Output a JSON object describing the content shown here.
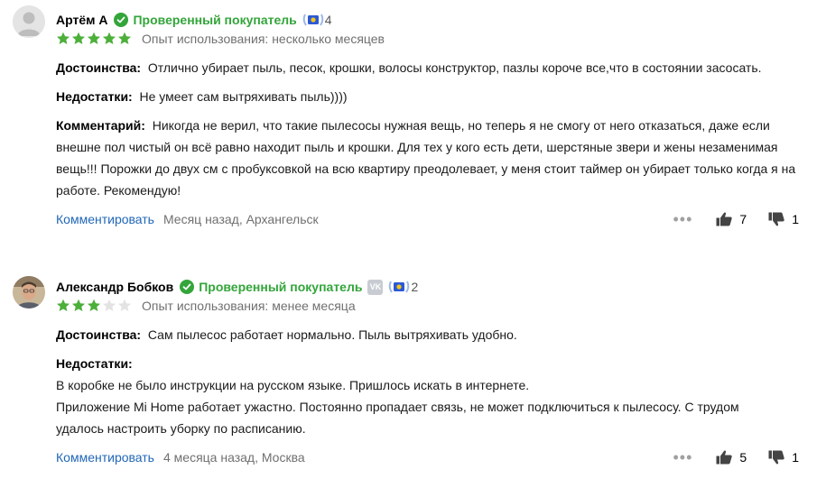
{
  "reviews": [
    {
      "author": "Артём А",
      "verified": "Проверенный покупатель",
      "badge_level": "4",
      "has_vk": false,
      "rating": 5,
      "usage": "Опыт использования: несколько месяцев",
      "pros_label": "Достоинства:",
      "pros": "Отлично убирает пыль, песок, крошки, волосы конструктор, пазлы короче все,что в состоянии засосать.",
      "cons_label": "Недостатки:",
      "cons": "Не умеет сам вытряхивать пыль))))",
      "comment_label": "Комментарий:",
      "comment_lines": [
        "Никогда не верил, что такие пылесосы нужная вещь, но теперь я не смогу от него отказаться, даже если",
        "внешне пол чистый он всё равно находит пыль и крошки. Для тех у кого есть дети, шерстяные звери и жены незаменимая",
        "вещь!!! Порожки до двух см с пробуксовкой на всю квартиру преодолевает, у меня стоит таймер он убирает только когда я на",
        "работе. Рекомендую!"
      ],
      "comment_action": "Комментировать",
      "meta": "Месяц назад, Архангельск",
      "likes": "7",
      "dislikes": "1"
    },
    {
      "author": "Александр Бобков",
      "verified": "Проверенный покупатель",
      "badge_level": "2",
      "has_vk": true,
      "vk_label": "VK",
      "rating": 3,
      "usage": "Опыт использования: менее месяца",
      "pros_label": "Достоинства:",
      "pros": "Сам пылесос работает нормально. Пыль вытряхивать удобно.",
      "cons_label": "Недостатки:",
      "cons_lines": [
        "В коробке не было инструкции на русском языке. Пришлось искать в интернете.",
        "Приложение Mi Home работает ужастно. Постоянно пропадает связь, не может подключиться к пылесосу. С трудом",
        "удалось настроить уборку по расписанию."
      ],
      "comment_action": "Комментировать",
      "meta": "4 месяца назад, Москва",
      "likes": "5",
      "dislikes": "1"
    }
  ],
  "colors": {
    "verified": "#33a53a",
    "star_filled": "#4caf3a",
    "star_empty": "#e3e3e3",
    "link": "#2167b7",
    "muted": "#707070",
    "badge": "#2b59d6"
  },
  "icons": [
    "avatar-placeholder-icon",
    "verified-check-icon",
    "laurel-badge-icon",
    "vk-icon",
    "star-icon",
    "more-dots-icon",
    "thumb-up-icon",
    "thumb-down-icon"
  ]
}
